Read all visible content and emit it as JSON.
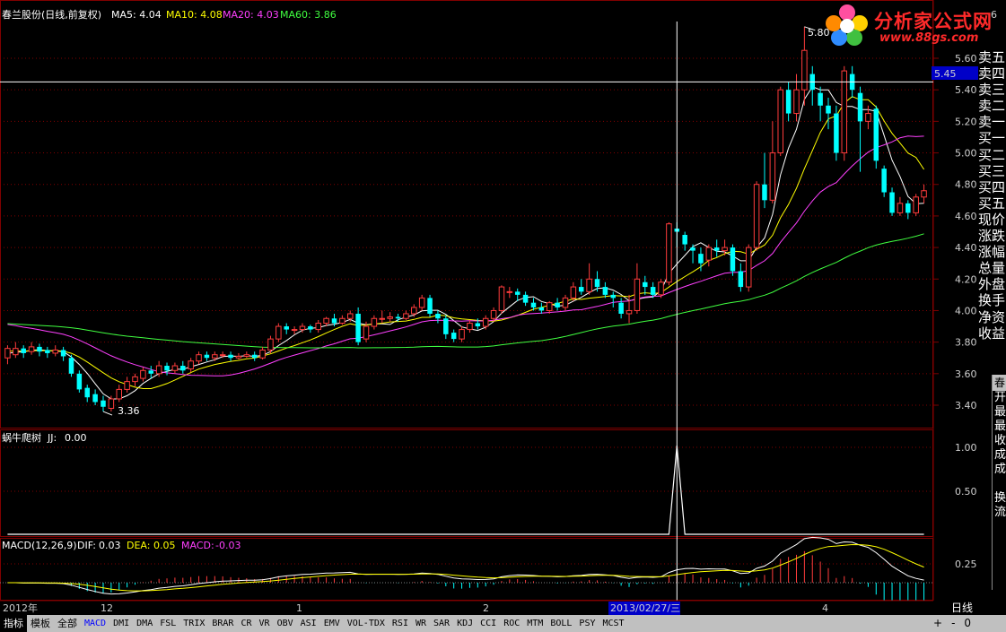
{
  "header": {
    "stock_name": "春兰股份(日线,前复权)",
    "ma": [
      {
        "label": "MA5:",
        "value": "4.04",
        "color": "#ffffff"
      },
      {
        "label": "MA10:",
        "value": "4.08",
        "color": "#ffff00"
      },
      {
        "label": "MA20:",
        "value": "4.03",
        "color": "#ff40ff"
      },
      {
        "label": "MA60:",
        "value": "3.86",
        "color": "#40ff40"
      }
    ]
  },
  "logo": {
    "text": "分析家公式网",
    "url": "www.88gs.com"
  },
  "price_axis": {
    "ticks": [
      "5.60",
      "5.40",
      "5.20",
      "5.00",
      "4.80",
      "4.60",
      "4.40",
      "4.20",
      "4.00",
      "3.80",
      "3.60",
      "3.40"
    ],
    "top_partial": "6",
    "cursor_price": "5.45"
  },
  "annotations": {
    "high": "5.80",
    "low": "3.36"
  },
  "indicator1": {
    "name": "蜗牛爬树",
    "jj_label": "JJ:",
    "jj_value": "0.00",
    "ticks": [
      "1.00",
      "0.50"
    ]
  },
  "macd": {
    "name": "MACD(12,26,9)",
    "dif_label": "DIF:",
    "dif_value": "0.03",
    "dea_label": "DEA:",
    "dea_value": "0.05",
    "macd_label": "MACD:",
    "macd_value": "-0.03",
    "tick": "0.25"
  },
  "time_axis": {
    "labels": [
      "2012年",
      "12",
      "1",
      "2",
      "4"
    ],
    "cursor_date": "2013/02/27/三"
  },
  "right_panel": {
    "items": [
      "卖五",
      "卖四",
      "卖三",
      "卖二",
      "卖一",
      "买一",
      "买二",
      "买三",
      "买四",
      "买五",
      "现价",
      "涨跌",
      "涨幅",
      "总量",
      "外盘",
      "换手",
      "净资",
      "收益"
    ]
  },
  "info_box": {
    "head": "春",
    "lines": [
      "开",
      "最",
      "最",
      "收",
      "成",
      "成",
      "",
      "换",
      "流"
    ]
  },
  "day_button": "日线",
  "zoom": {
    "plus": "+",
    "minus": "-",
    "zero": "0"
  },
  "bottom_tabs": [
    "指标",
    "模板",
    "全部"
  ],
  "indicators": [
    "MACD",
    "DMI",
    "DMA",
    "FSL",
    "TRIX",
    "BRAR",
    "CR",
    "VR",
    "OBV",
    "ASI",
    "EMV",
    "VOL-TDX",
    "RSI",
    "WR",
    "SAR",
    "KDJ",
    "CCI",
    "ROC",
    "MTM",
    "BOLL",
    "PSY",
    "MCST"
  ],
  "selected_indicator": "MACD",
  "colors": {
    "up": "#ff3c3c",
    "down": "#00ffff",
    "grid": "#800000",
    "ma5": "#ffffff",
    "ma10": "#ffff00",
    "ma20": "#ff40ff",
    "ma60": "#40ff40"
  },
  "chart_data": {
    "type": "candlestick",
    "price_range": [
      3.28,
      5.86
    ],
    "candles": [
      [
        3.7,
        3.76,
        3.66,
        3.78
      ],
      [
        3.72,
        3.76,
        3.7,
        3.8
      ],
      [
        3.76,
        3.73,
        3.7,
        3.78
      ],
      [
        3.74,
        3.77,
        3.72,
        3.8
      ],
      [
        3.77,
        3.74,
        3.71,
        3.79
      ],
      [
        3.75,
        3.73,
        3.7,
        3.77
      ],
      [
        3.73,
        3.75,
        3.71,
        3.78
      ],
      [
        3.75,
        3.71,
        3.68,
        3.77
      ],
      [
        3.7,
        3.6,
        3.58,
        3.72
      ],
      [
        3.6,
        3.5,
        3.48,
        3.62
      ],
      [
        3.51,
        3.45,
        3.42,
        3.53
      ],
      [
        3.47,
        3.42,
        3.4,
        3.5
      ],
      [
        3.43,
        3.39,
        3.36,
        3.46
      ],
      [
        3.38,
        3.44,
        3.36,
        3.46
      ],
      [
        3.44,
        3.5,
        3.42,
        3.53
      ],
      [
        3.5,
        3.55,
        3.48,
        3.58
      ],
      [
        3.55,
        3.58,
        3.52,
        3.6
      ],
      [
        3.57,
        3.62,
        3.55,
        3.64
      ],
      [
        3.62,
        3.6,
        3.57,
        3.65
      ],
      [
        3.6,
        3.65,
        3.58,
        3.68
      ],
      [
        3.65,
        3.62,
        3.59,
        3.67
      ],
      [
        3.62,
        3.65,
        3.6,
        3.67
      ],
      [
        3.65,
        3.62,
        3.6,
        3.68
      ],
      [
        3.63,
        3.68,
        3.61,
        3.7
      ],
      [
        3.68,
        3.72,
        3.66,
        3.74
      ],
      [
        3.72,
        3.7,
        3.68,
        3.74
      ],
      [
        3.7,
        3.72,
        3.68,
        3.74
      ],
      [
        3.72,
        3.72,
        3.7,
        3.74
      ],
      [
        3.72,
        3.7,
        3.68,
        3.74
      ],
      [
        3.7,
        3.71,
        3.69,
        3.73
      ],
      [
        3.71,
        3.72,
        3.7,
        3.74
      ],
      [
        3.72,
        3.7,
        3.68,
        3.74
      ],
      [
        3.7,
        3.75,
        3.69,
        3.77
      ],
      [
        3.75,
        3.82,
        3.73,
        3.84
      ],
      [
        3.82,
        3.9,
        3.8,
        3.92
      ],
      [
        3.9,
        3.88,
        3.85,
        3.92
      ],
      [
        3.88,
        3.88,
        3.85,
        3.9
      ],
      [
        3.88,
        3.9,
        3.86,
        3.92
      ],
      [
        3.9,
        3.88,
        3.86,
        3.91
      ],
      [
        3.88,
        3.92,
        3.86,
        3.94
      ],
      [
        3.92,
        3.95,
        3.9,
        3.96
      ],
      [
        3.95,
        3.92,
        3.9,
        3.98
      ],
      [
        3.92,
        3.95,
        3.91,
        3.97
      ],
      [
        3.95,
        3.98,
        3.93,
        4.0
      ],
      [
        3.98,
        3.8,
        3.78,
        4.02
      ],
      [
        3.82,
        3.9,
        3.8,
        3.93
      ],
      [
        3.9,
        3.95,
        3.88,
        3.97
      ],
      [
        3.95,
        3.95,
        3.92,
        4.0
      ],
      [
        3.95,
        3.96,
        3.93,
        3.99
      ],
      [
        3.96,
        3.95,
        3.93,
        3.98
      ],
      [
        3.95,
        3.98,
        3.94,
        4.0
      ],
      [
        3.98,
        4.02,
        3.96,
        4.04
      ],
      [
        4.02,
        4.08,
        4.0,
        4.1
      ],
      [
        4.08,
        3.98,
        3.96,
        4.1
      ],
      [
        3.98,
        3.95,
        3.92,
        4.0
      ],
      [
        3.95,
        3.85,
        3.82,
        3.97
      ],
      [
        3.86,
        3.82,
        3.8,
        3.88
      ],
      [
        3.82,
        3.88,
        3.8,
        3.9
      ],
      [
        3.88,
        3.92,
        3.86,
        3.94
      ],
      [
        3.92,
        3.9,
        3.88,
        3.95
      ],
      [
        3.9,
        3.95,
        3.88,
        3.97
      ],
      [
        3.95,
        4.0,
        3.93,
        4.02
      ],
      [
        4.0,
        4.15,
        3.98,
        4.16
      ],
      [
        4.12,
        4.12,
        4.08,
        4.15
      ],
      [
        4.12,
        4.1,
        4.06,
        4.14
      ],
      [
        4.1,
        4.05,
        4.03,
        4.12
      ],
      [
        4.05,
        4.02,
        4.0,
        4.08
      ],
      [
        4.02,
        4.0,
        3.98,
        4.05
      ],
      [
        4.0,
        4.05,
        3.98,
        4.06
      ],
      [
        4.05,
        4.02,
        4.0,
        4.08
      ],
      [
        4.02,
        4.08,
        4.0,
        4.1
      ],
      [
        4.08,
        4.15,
        4.06,
        4.18
      ],
      [
        4.15,
        4.12,
        4.1,
        4.2
      ],
      [
        4.12,
        4.2,
        4.1,
        4.3
      ],
      [
        4.2,
        4.15,
        4.12,
        4.25
      ],
      [
        4.15,
        4.1,
        4.08,
        4.18
      ],
      [
        4.1,
        4.08,
        4.02,
        4.12
      ],
      [
        4.05,
        3.98,
        3.95,
        4.08
      ],
      [
        3.98,
        4.0,
        3.92,
        4.1
      ],
      [
        4.0,
        4.2,
        3.98,
        4.3
      ],
      [
        4.18,
        4.15,
        4.1,
        4.22
      ],
      [
        4.15,
        4.1,
        4.08,
        4.18
      ],
      [
        4.1,
        4.18,
        4.08,
        4.2
      ],
      [
        4.18,
        4.55,
        4.16,
        4.56
      ],
      [
        4.52,
        4.5,
        4.4,
        4.56
      ],
      [
        4.48,
        4.42,
        4.38,
        4.5
      ],
      [
        4.4,
        4.38,
        4.3,
        4.42
      ],
      [
        4.36,
        4.3,
        4.25,
        4.4
      ],
      [
        4.32,
        4.4,
        4.28,
        4.42
      ],
      [
        4.4,
        4.38,
        4.34,
        4.45
      ],
      [
        4.38,
        4.4,
        4.35,
        4.45
      ],
      [
        4.4,
        4.25,
        4.22,
        4.42
      ],
      [
        4.25,
        4.15,
        4.12,
        4.3
      ],
      [
        4.15,
        4.4,
        4.12,
        4.42
      ],
      [
        4.4,
        4.8,
        4.38,
        4.82
      ],
      [
        4.8,
        4.7,
        4.65,
        5.0
      ],
      [
        4.7,
        5.0,
        4.68,
        5.2
      ],
      [
        5.0,
        5.4,
        4.98,
        5.42
      ],
      [
        5.4,
        5.25,
        5.2,
        5.45
      ],
      [
        5.25,
        5.4,
        5.2,
        5.5
      ],
      [
        5.4,
        5.65,
        5.3,
        5.8
      ],
      [
        5.5,
        5.4,
        5.3,
        5.55
      ],
      [
        5.38,
        5.3,
        5.2,
        5.42
      ],
      [
        5.3,
        5.25,
        5.15,
        5.35
      ],
      [
        5.25,
        5.0,
        4.95,
        5.3
      ],
      [
        5.0,
        5.52,
        4.95,
        5.55
      ],
      [
        5.5,
        5.4,
        5.35,
        5.55
      ],
      [
        5.38,
        5.2,
        4.88,
        5.42
      ],
      [
        5.2,
        5.25,
        5.15,
        5.3
      ],
      [
        5.28,
        4.95,
        4.9,
        5.3
      ],
      [
        4.9,
        4.75,
        4.72,
        4.92
      ],
      [
        4.75,
        4.62,
        4.6,
        4.78
      ],
      [
        4.62,
        4.68,
        4.6,
        4.72
      ],
      [
        4.68,
        4.62,
        4.58,
        4.7
      ],
      [
        4.62,
        4.72,
        4.6,
        4.74
      ],
      [
        4.72,
        4.76,
        4.68,
        4.8
      ]
    ],
    "jj_spike_index": 84,
    "cursor_index": 84
  }
}
